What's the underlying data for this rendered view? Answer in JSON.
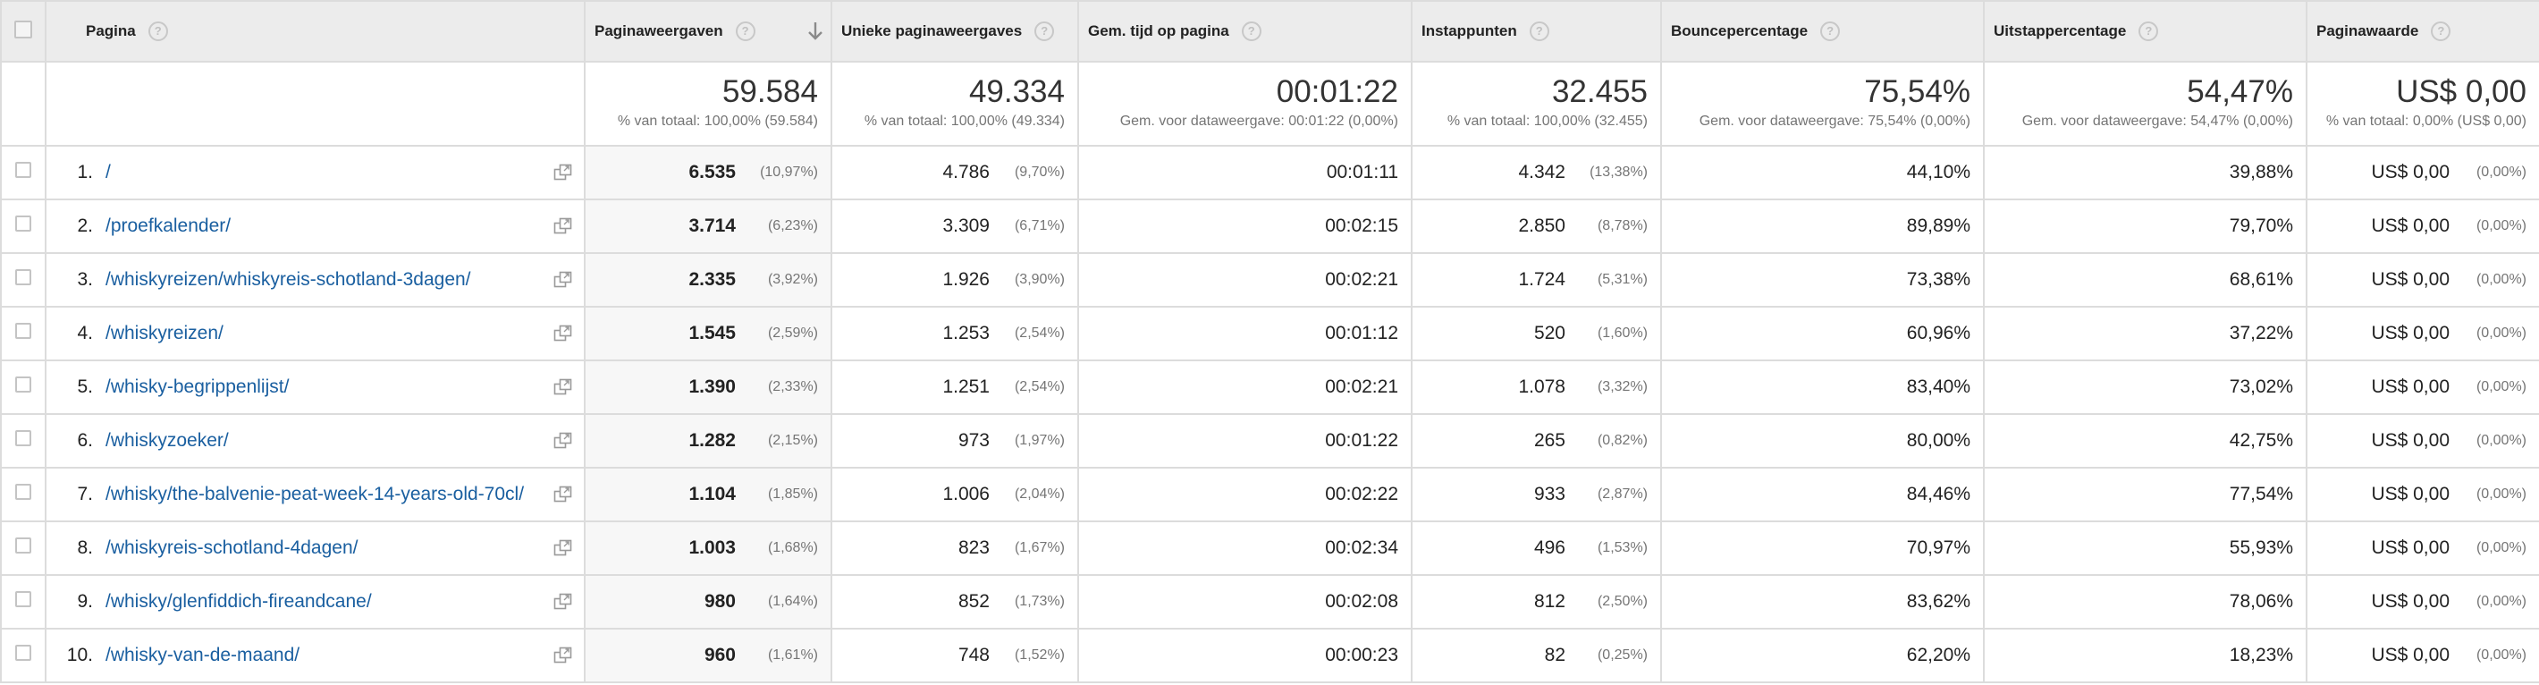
{
  "columns": {
    "pagina": "Pagina",
    "paginaweergaven": "Paginaweergaven",
    "unieke": "Unieke paginaweergaves",
    "tijd": "Gem. tijd op pagina",
    "instap": "Instappunten",
    "bounce": "Bouncepercentage",
    "uitstap": "Uitstappercentage",
    "waarde": "Paginawaarde"
  },
  "help_glyph": "?",
  "totals": {
    "paginaweergaven": {
      "value": "59.584",
      "sub": "% van totaal: 100,00% (59.584)"
    },
    "unieke": {
      "value": "49.334",
      "sub": "% van totaal: 100,00% (49.334)"
    },
    "tijd": {
      "value": "00:01:22",
      "sub": "Gem. voor dataweergave: 00:01:22 (0,00%)"
    },
    "instap": {
      "value": "32.455",
      "sub": "% van totaal: 100,00% (32.455)"
    },
    "bounce": {
      "value": "75,54%",
      "sub": "Gem. voor dataweergave: 75,54% (0,00%)"
    },
    "uitstap": {
      "value": "54,47%",
      "sub": "Gem. voor dataweergave: 54,47% (0,00%)"
    },
    "waarde": {
      "value": "US$ 0,00",
      "sub": "% van totaal: 0,00% (US$ 0,00)"
    }
  },
  "rows": [
    {
      "idx": "1.",
      "page": "/",
      "pv": "6.535",
      "pv_pct": "(10,97%)",
      "upv": "4.786",
      "upv_pct": "(9,70%)",
      "time": "00:01:11",
      "entr": "4.342",
      "entr_pct": "(13,38%)",
      "bounce": "44,10%",
      "exit": "39,88%",
      "val": "US$ 0,00",
      "val_pct": "(0,00%)"
    },
    {
      "idx": "2.",
      "page": "/proefkalender/",
      "pv": "3.714",
      "pv_pct": "(6,23%)",
      "upv": "3.309",
      "upv_pct": "(6,71%)",
      "time": "00:02:15",
      "entr": "2.850",
      "entr_pct": "(8,78%)",
      "bounce": "89,89%",
      "exit": "79,70%",
      "val": "US$ 0,00",
      "val_pct": "(0,00%)"
    },
    {
      "idx": "3.",
      "page": "/whiskyreizen/whiskyreis-schotland-3dagen/",
      "pv": "2.335",
      "pv_pct": "(3,92%)",
      "upv": "1.926",
      "upv_pct": "(3,90%)",
      "time": "00:02:21",
      "entr": "1.724",
      "entr_pct": "(5,31%)",
      "bounce": "73,38%",
      "exit": "68,61%",
      "val": "US$ 0,00",
      "val_pct": "(0,00%)"
    },
    {
      "idx": "4.",
      "page": "/whiskyreizen/",
      "pv": "1.545",
      "pv_pct": "(2,59%)",
      "upv": "1.253",
      "upv_pct": "(2,54%)",
      "time": "00:01:12",
      "entr": "520",
      "entr_pct": "(1,60%)",
      "bounce": "60,96%",
      "exit": "37,22%",
      "val": "US$ 0,00",
      "val_pct": "(0,00%)"
    },
    {
      "idx": "5.",
      "page": "/whisky-begrippenlijst/",
      "pv": "1.390",
      "pv_pct": "(2,33%)",
      "upv": "1.251",
      "upv_pct": "(2,54%)",
      "time": "00:02:21",
      "entr": "1.078",
      "entr_pct": "(3,32%)",
      "bounce": "83,40%",
      "exit": "73,02%",
      "val": "US$ 0,00",
      "val_pct": "(0,00%)"
    },
    {
      "idx": "6.",
      "page": "/whiskyzoeker/",
      "pv": "1.282",
      "pv_pct": "(2,15%)",
      "upv": "973",
      "upv_pct": "(1,97%)",
      "time": "00:01:22",
      "entr": "265",
      "entr_pct": "(0,82%)",
      "bounce": "80,00%",
      "exit": "42,75%",
      "val": "US$ 0,00",
      "val_pct": "(0,00%)"
    },
    {
      "idx": "7.",
      "page": "/whisky/the-balvenie-peat-week-14-years-old-70cl/",
      "pv": "1.104",
      "pv_pct": "(1,85%)",
      "upv": "1.006",
      "upv_pct": "(2,04%)",
      "time": "00:02:22",
      "entr": "933",
      "entr_pct": "(2,87%)",
      "bounce": "84,46%",
      "exit": "77,54%",
      "val": "US$ 0,00",
      "val_pct": "(0,00%)"
    },
    {
      "idx": "8.",
      "page": "/whiskyreis-schotland-4dagen/",
      "pv": "1.003",
      "pv_pct": "(1,68%)",
      "upv": "823",
      "upv_pct": "(1,67%)",
      "time": "00:02:34",
      "entr": "496",
      "entr_pct": "(1,53%)",
      "bounce": "70,97%",
      "exit": "55,93%",
      "val": "US$ 0,00",
      "val_pct": "(0,00%)"
    },
    {
      "idx": "9.",
      "page": "/whisky/glenfiddich-fireandcane/",
      "pv": "980",
      "pv_pct": "(1,64%)",
      "upv": "852",
      "upv_pct": "(1,73%)",
      "time": "00:02:08",
      "entr": "812",
      "entr_pct": "(2,50%)",
      "bounce": "83,62%",
      "exit": "78,06%",
      "val": "US$ 0,00",
      "val_pct": "(0,00%)"
    },
    {
      "idx": "10.",
      "page": "/whisky-van-de-maand/",
      "pv": "960",
      "pv_pct": "(1,61%)",
      "upv": "748",
      "upv_pct": "(1,52%)",
      "time": "00:00:23",
      "entr": "82",
      "entr_pct": "(0,25%)",
      "bounce": "62,20%",
      "exit": "18,23%",
      "val": "US$ 0,00",
      "val_pct": "(0,00%)"
    }
  ],
  "colors": {
    "link": "#1a5fa0",
    "header_bg": "#ececec",
    "border": "#dcdcdc",
    "muted": "#757575"
  },
  "icons": {
    "sort": "arrow-down-icon",
    "external": "open-in-new-window-icon",
    "help": "help-circle-icon"
  }
}
